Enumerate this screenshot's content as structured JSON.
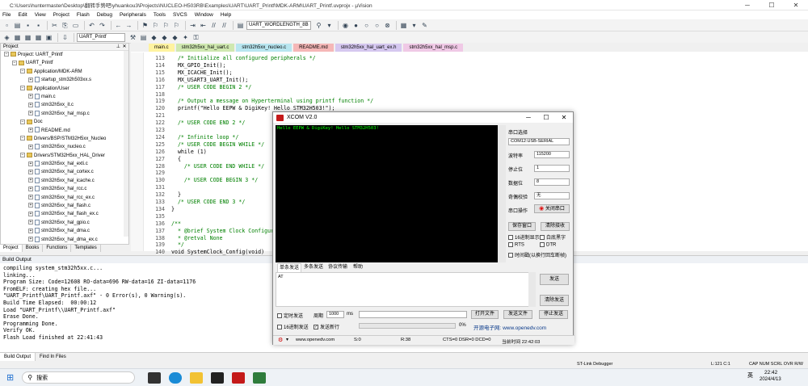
{
  "window": {
    "title": "C:\\Users\\huntermaster\\Desktop\\翻转手势吧\\yhuankou3\\Projects\\NUCLEO-H503RB\\Examples\\UART\\UART_Printf\\MDK-ARM\\UART_Printf.uvprojx - µVision"
  },
  "menu": [
    "File",
    "Edit",
    "View",
    "Project",
    "Flash",
    "Debug",
    "Peripherals",
    "Tools",
    "SVCS",
    "Window",
    "Help"
  ],
  "toolbar": {
    "search_combo": "UART_WORDLENGTH_8B",
    "target_combo": "UART_Printf"
  },
  "project": {
    "title": "Project",
    "tree": [
      {
        "label": "Project: UART_Printf",
        "indent": 0,
        "kind": "root"
      },
      {
        "label": "UART_Printf",
        "indent": 1,
        "kind": "folder"
      },
      {
        "label": "Application/MDK-ARM",
        "indent": 2,
        "kind": "folder"
      },
      {
        "label": "startup_stm32h503xx.s",
        "indent": 3,
        "kind": "file"
      },
      {
        "label": "Application/User",
        "indent": 2,
        "kind": "folder"
      },
      {
        "label": "main.c",
        "indent": 3,
        "kind": "file"
      },
      {
        "label": "stm32h5xx_it.c",
        "indent": 3,
        "kind": "file"
      },
      {
        "label": "stm32h5xx_hal_msp.c",
        "indent": 3,
        "kind": "file"
      },
      {
        "label": "Doc",
        "indent": 2,
        "kind": "folder"
      },
      {
        "label": "README.md",
        "indent": 3,
        "kind": "file"
      },
      {
        "label": "Drivers/BSP/STM32H5xx_Nucleo",
        "indent": 2,
        "kind": "folder"
      },
      {
        "label": "stm32h5xx_nucleo.c",
        "indent": 3,
        "kind": "file"
      },
      {
        "label": "Drivers/STM32H5xx_HAL_Driver",
        "indent": 2,
        "kind": "folder"
      },
      {
        "label": "stm32h5xx_hal_exti.c",
        "indent": 3,
        "kind": "file"
      },
      {
        "label": "stm32h5xx_hal_cortex.c",
        "indent": 3,
        "kind": "file"
      },
      {
        "label": "stm32h5xx_hal_icache.c",
        "indent": 3,
        "kind": "file"
      },
      {
        "label": "stm32h5xx_hal_rcc.c",
        "indent": 3,
        "kind": "file"
      },
      {
        "label": "stm32h5xx_hal_rcc_ex.c",
        "indent": 3,
        "kind": "file"
      },
      {
        "label": "stm32h5xx_hal_flash.c",
        "indent": 3,
        "kind": "file"
      },
      {
        "label": "stm32h5xx_hal_flash_ex.c",
        "indent": 3,
        "kind": "file"
      },
      {
        "label": "stm32h5xx_hal_gpio.c",
        "indent": 3,
        "kind": "file"
      },
      {
        "label": "stm32h5xx_hal_dma.c",
        "indent": 3,
        "kind": "file"
      },
      {
        "label": "stm32h5xx_hal_dma_ex.c",
        "indent": 3,
        "kind": "file"
      }
    ],
    "tabs": [
      "Project",
      "Books",
      "Functions",
      "Templates"
    ]
  },
  "editor": {
    "tabs": [
      {
        "label": "main.c",
        "color": "#fff3a0"
      },
      {
        "label": "stm32h5xx_hal_uart.c",
        "color": "#cfe8b0"
      },
      {
        "label": "stm32h5xx_nucleo.c",
        "color": "#b8e6f0"
      },
      {
        "label": "README.md",
        "color": "#f5b7b7"
      },
      {
        "label": "stm32h5xx_hal_uart_ex.h",
        "color": "#d6c8f0"
      },
      {
        "label": "stm32h5xx_hal_msp.c",
        "color": "#f0c9e6"
      }
    ],
    "lines": [
      {
        "n": "113",
        "t": "  /* Initialize all configured peripherals */",
        "c": true
      },
      {
        "n": "114",
        "t": "  MX_GPIO_Init();",
        "c": false
      },
      {
        "n": "115",
        "t": "  MX_ICACHE_Init();",
        "c": false
      },
      {
        "n": "116",
        "t": "  MX_USART3_UART_Init();",
        "c": false
      },
      {
        "n": "117",
        "t": "  /* USER CODE BEGIN 2 */",
        "c": true
      },
      {
        "n": "118",
        "t": "",
        "c": false
      },
      {
        "n": "119",
        "t": "  /* Output a message on Hyperterminal using printf function */",
        "c": true
      },
      {
        "n": "120",
        "t": "  printf(\"Hello EEPW & DigiKey! Hello STM32H503!\");",
        "c": false
      },
      {
        "n": "121",
        "t": "",
        "c": false
      },
      {
        "n": "122",
        "t": "  /* USER CODE END 2 */",
        "c": true
      },
      {
        "n": "123",
        "t": "",
        "c": false
      },
      {
        "n": "124",
        "t": "  /* Infinite loop */",
        "c": true
      },
      {
        "n": "125",
        "t": "  /* USER CODE BEGIN WHILE */",
        "c": true
      },
      {
        "n": "126",
        "t": "  while (1)",
        "c": false
      },
      {
        "n": "127",
        "t": "  {",
        "c": false
      },
      {
        "n": "128",
        "t": "    /* USER CODE END WHILE */",
        "c": true
      },
      {
        "n": "129",
        "t": "",
        "c": false
      },
      {
        "n": "130",
        "t": "    /* USER CODE BEGIN 3 */",
        "c": true
      },
      {
        "n": "131",
        "t": "",
        "c": false
      },
      {
        "n": "132",
        "t": "  }",
        "c": false
      },
      {
        "n": "133",
        "t": "  /* USER CODE END 3 */",
        "c": true
      },
      {
        "n": "134",
        "t": "}",
        "c": false
      },
      {
        "n": "135",
        "t": "",
        "c": false
      },
      {
        "n": "136",
        "t": "/**",
        "c": true
      },
      {
        "n": "137",
        "t": "  * @brief System Clock Configuration",
        "c": true
      },
      {
        "n": "138",
        "t": "  * @retval None",
        "c": true
      },
      {
        "n": "139",
        "t": "  */",
        "c": true
      },
      {
        "n": "140",
        "t": "void SystemClock_Config(void)",
        "c": false
      }
    ]
  },
  "build": {
    "title": "Build Output",
    "lines": [
      "compiling system_stm32h5xx.c...",
      "linking...",
      "Program Size: Code=12608 RO-data=696 RW-data=16 ZI-data=1176",
      "FromELF: creating hex file...",
      "\"UART_Printf\\UART_Printf.axf\" - 0 Error(s), 0 Warning(s).",
      "Build Time Elapsed:  00:00:12",
      "Load \"UART_Printf\\\\UART_Printf.axf\"",
      "Erase Done.",
      "Programming Done.",
      "Verify OK.",
      "Flash Load finished at 22:41:43"
    ],
    "tabs": [
      "Build Output",
      "Find In Files"
    ]
  },
  "status": {
    "debugger": "ST-Link Debugger",
    "pos": "L:121 C:1",
    "flags": "CAP  NUM  SCRL  OVR  R/W"
  },
  "xcom": {
    "title": "XCOM V2.0",
    "received": "Hello EEPW & DigiKey! Hello STM32H503!",
    "labels": {
      "port": "串口选择",
      "baud": "波特率",
      "stop": "停止位",
      "data": "数据位",
      "parity": "奇偶校验",
      "op": "串口操作"
    },
    "values": {
      "port": "COM12:USB-SERIAL",
      "baud": "115200",
      "stop": "1",
      "data": "8",
      "parity": "无"
    },
    "close_port": "关闭串口",
    "save_window": "保存窗口",
    "clear_recv": "清除接收",
    "hex_show": "16进制显示",
    "white_black": "白底黑字",
    "rts": "RTS",
    "dtr": "DTR",
    "timestamp": "时间戳(以换行回车断帧)",
    "tabs": [
      "单条发送",
      "多条发送",
      "协议传输",
      "帮助"
    ],
    "send_text": "AT",
    "send_btn": "发送",
    "clear_send_btn": "清除发送",
    "timed_send": "定时发送",
    "period_label": "周期",
    "period_value": "1000",
    "ms": "ms",
    "hex_send": "16进制发送",
    "send_newline": "发送新行",
    "open_file": "打开文件",
    "send_file": "发送文件",
    "stop_send": "停止发送",
    "progress": "0%",
    "brand": "开源电子网: www.openedv.com",
    "status": {
      "url": "www.openedv.com",
      "s": "S:0",
      "r": "R:38",
      "cts": "CTS=0 DSR=0 DCD=0",
      "time": "当前时间 22:42:03"
    }
  },
  "taskbar": {
    "search": "搜索",
    "time": "22:42",
    "date": "2024/4/13",
    "lang": "英"
  }
}
